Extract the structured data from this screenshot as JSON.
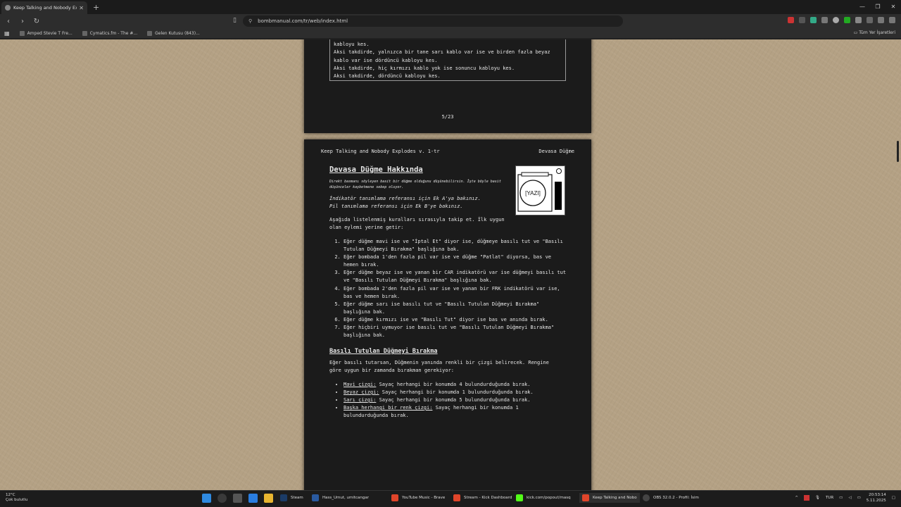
{
  "browser": {
    "tab_title": "Keep Talking and Nobody Explode",
    "url": "bombmanual.com/tr/web/index.html",
    "bookmarks": [
      "Amped Stevie T Fre...",
      "Cymatics.fm - The #...",
      "Gelen Kutusu (843)..."
    ],
    "all_bookmarks": "Tüm Yer İşaretleri"
  },
  "page1": {
    "table_lines": [
      "kabloyu kes.",
      "Aksi takdirde, yalnızca bir tane sarı kablo var ise ve birden fazla beyaz",
      "kablo var ise dördüncü kabloyu kes.",
      "Aksi takdirde, hiç kırmızı kablo yok ise sonuncu kabloyu kes.",
      "Aksi takdirde, dördüncü kabloyu kes."
    ],
    "page_number": "5/23"
  },
  "page2": {
    "header_left": "Keep Talking and Nobody Explodes v. 1-tr",
    "header_right": "Devasa Düğme",
    "title": "Devasa Düğme Hakkında",
    "flavor": "Direkt basmanı söyleyen basit bir düğme olduğunu düşünebilirsin. İşte böyle basit düşünceler kaybetmene sebep oluyor.",
    "ref_a": "İndikatör tanımlama referansı için Ek A'ya bakınız.",
    "ref_b": "Pil tanımlama referansı için Ek B'ye bakınız.",
    "intro": "Aşağıda listelenmiş kuralları sırasıyla takip et. İlk uygun olan eylemi yerine getir:",
    "module_label": "[YAZI]",
    "steps": [
      "Eğer düğme mavi ise ve \"İptal Et\" diyor ise, düğmeye basılı tut ve \"Basılı Tutulan Düğmeyi Bırakma\" başlığına bak.",
      "Eğer bombada 1'den fazla pil var ise ve düğme \"Patlat\" diyorsa, bas ve hemen bırak.",
      "Eğer düğme beyaz ise ve yanan bir CAR indikatörü var ise düğmeyi basılı tut ve \"Basılı Tutulan Düğmeyi Bırakma\" başlığına bak.",
      "Eğer bombada 2'den fazla pil var ise ve yanan bir FRK indikatörü var ise, bas ve hemen bırak.",
      "Eğer düğme sarı ise basılı tut ve \"Basılı Tutulan Düğmeyi Bırakma\" başlığına bak.",
      "Eğer düğme kırmızı ise ve \"Basılı Tut\" diyor ise bas ve anında bırak.",
      "Eğer hiçbiri uymuyor ise basılı tut ve \"Basılı Tutulan Düğmeyi Bırakma\" başlığına bak."
    ],
    "subtitle": "Basılı Tutulan Düğmeyi Bırakma",
    "release_intro": "Eğer basılı tutarsan, Düğmenin yanında renkli bir çizgi belirecek. Rengine göre uygun bir zamanda bırakman gerekiyor:",
    "bullets": [
      {
        "key": "Mavi çizgi:",
        "text": " Sayaç herhangi bir konumda 4 bulundurduğunda bırak."
      },
      {
        "key": "Beyaz çizgi:",
        "text": " Sayaç herhangi bir konumda 1 bulundurduğunda bırak."
      },
      {
        "key": "Sarı çizgi:",
        "text": " Sayaç herhangi bir konumda 5 bulundurduğunda bırak."
      },
      {
        "key": "Başka herhangi bir renk çizgi:",
        "text": " Sayaç herhangi bir konumda 1 bulundurduğunda bırak."
      }
    ]
  },
  "taskbar": {
    "temp": "12°C",
    "weather": "Çok bulutlu",
    "apps": [
      {
        "label": "Steam",
        "color": "#1b3b66"
      },
      {
        "label": "Hass_Umut, umitcangar",
        "color": "#2a5aa0"
      },
      {
        "label": "YouTube Music - Brave",
        "color": "#e0452a"
      },
      {
        "label": "Stream - Kick Dashboard",
        "color": "#e0452a"
      },
      {
        "label": "kick.com/popout/masq",
        "color": "#53fc18"
      },
      {
        "label": "Keep Talking and Nobo",
        "color": "#e0452a"
      },
      {
        "label": "OBS 32.0.2 - Profil: İsim",
        "color": "#444"
      }
    ],
    "lang": "TUR",
    "time": "20:53:14",
    "date": "5.11.2025"
  }
}
